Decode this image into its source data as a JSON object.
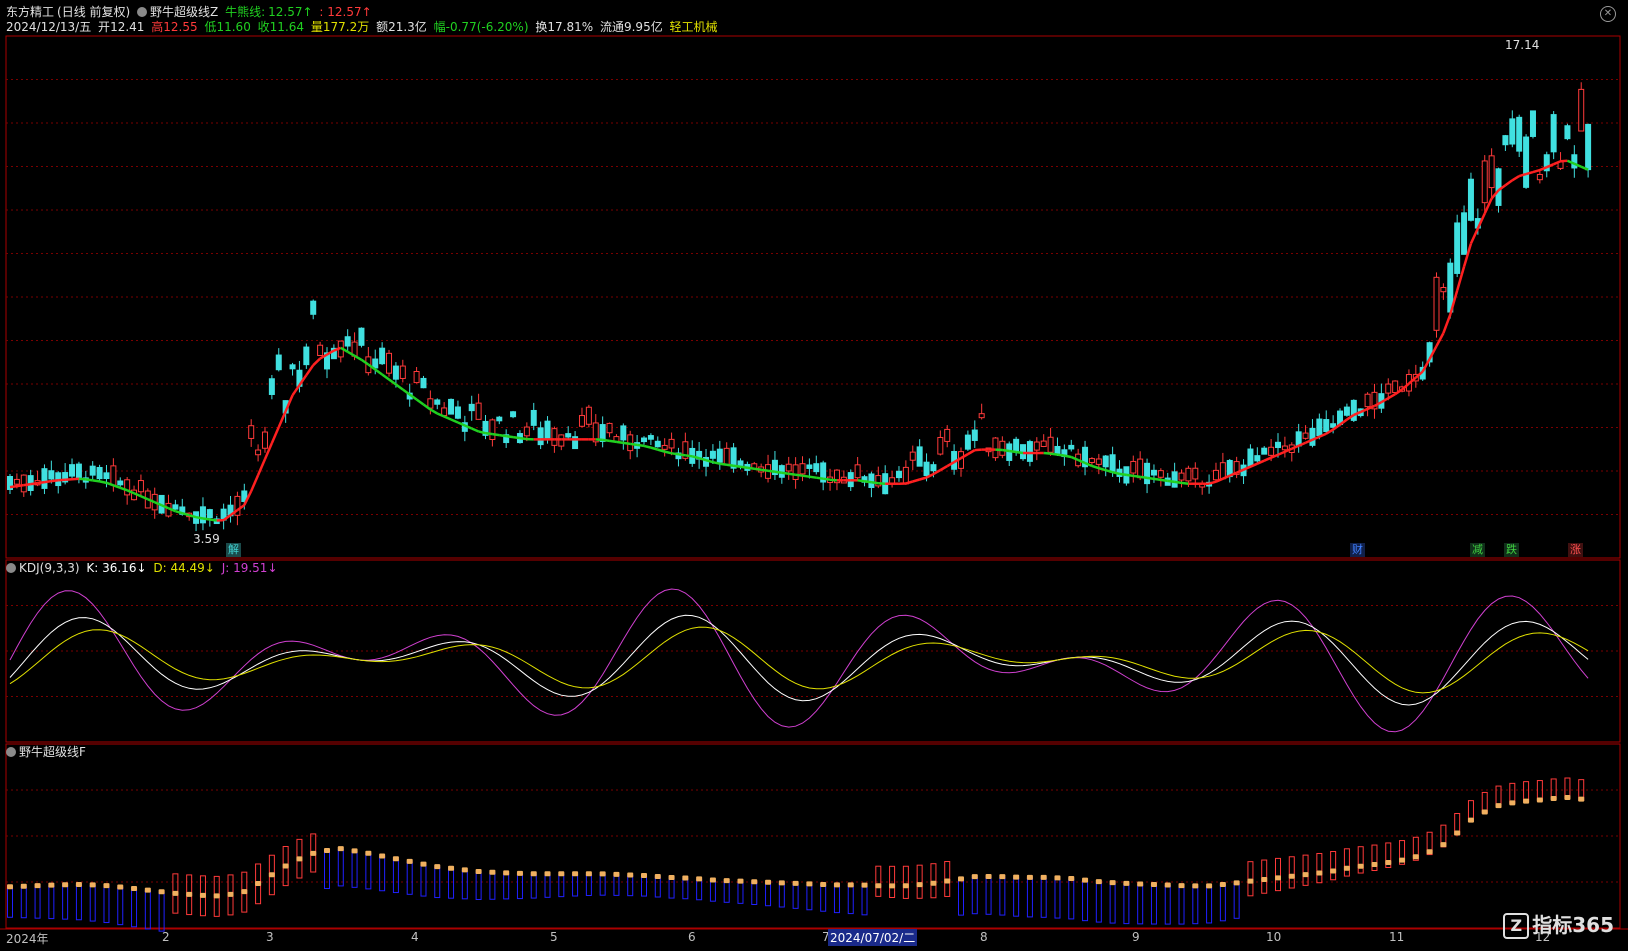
{
  "window": {
    "stock_name": "东方精工",
    "period_mode": "(日线 前复权)",
    "indicator_name": "野牛超级线Z",
    "bull_bear_label": "牛熊线:",
    "bull_bear_value": "12.57↑",
    "sep_value": ": 12.57↑"
  },
  "quote": {
    "date": "2024/12/13/五",
    "open_label": "开",
    "open": "12.41",
    "high_label": "高",
    "high": "12.55",
    "low_label": "低",
    "low": "11.60",
    "close_label": "收",
    "close": "11.64",
    "volume_label": "量",
    "volume": "177.2万",
    "amount_label": "额",
    "amount": "21.3亿",
    "change_label": "幅",
    "change": "-0.77(-6.20%)",
    "turnover_label": "换",
    "turnover": "17.81%",
    "float_label": "流通",
    "float_value": "9.95亿",
    "sector": "轻工机械"
  },
  "main_chart": {
    "max_label": "17.14",
    "min_label": "3.59",
    "markers": [
      {
        "text": "解",
        "color": "#40d0d0"
      },
      {
        "text": "财",
        "color": "#4080ff"
      },
      {
        "text": "减",
        "color": "#40d040"
      },
      {
        "text": "跌",
        "color": "#40d040"
      },
      {
        "text": "涨",
        "color": "#ff5050"
      }
    ]
  },
  "kdj": {
    "title": "KDJ(9,3,3)",
    "k_label": "K: 36.16↓",
    "d_label": "D: 44.49↓",
    "j_label": "J: 19.51↓"
  },
  "lower": {
    "title": "野牛超级线F"
  },
  "x_axis": {
    "labels": [
      "2024年",
      "2",
      "3",
      "4",
      "5",
      "6",
      "7",
      "8",
      "9",
      "10",
      "11",
      "12"
    ],
    "cursor_label": "2024/07/02/二"
  },
  "logo_text": "指标365",
  "colors": {
    "up": "#ff3a3a",
    "down": "#40e0e0",
    "bull_line": "#ff2020",
    "bear_line": "#20d020",
    "k": "#ffffff",
    "d": "#e0e000",
    "j": "#d040d0",
    "grid": "#7a0000"
  },
  "chart_data": {
    "type": "candlestick",
    "series": [
      {
        "name": "牛熊线",
        "values": [
          4.9,
          5.0,
          5.1,
          5.15,
          5.05,
          4.8,
          4.5,
          4.2,
          4.0,
          3.9,
          4.4,
          6.0,
          7.6,
          8.6,
          9.0,
          8.6,
          8.1,
          7.6,
          7.1,
          6.8,
          6.5,
          6.4,
          6.3,
          6.3,
          6.3,
          6.3,
          6.2,
          6.1,
          5.9,
          5.8,
          5.6,
          5.5,
          5.4,
          5.3,
          5.2,
          5.1,
          5.1,
          5.0,
          5.0,
          5.2,
          5.6,
          6.0,
          6.0,
          5.9,
          5.9,
          5.8,
          5.5,
          5.3,
          5.2,
          5.1,
          5.0,
          5.0,
          5.3,
          5.6,
          5.9,
          6.2,
          6.5,
          7.0,
          7.3,
          7.7,
          8.3,
          9.6,
          12.0,
          13.5,
          14.0,
          14.2,
          14.5,
          14.2
        ]
      }
    ],
    "ylim": [
      3.0,
      18.0
    ]
  }
}
